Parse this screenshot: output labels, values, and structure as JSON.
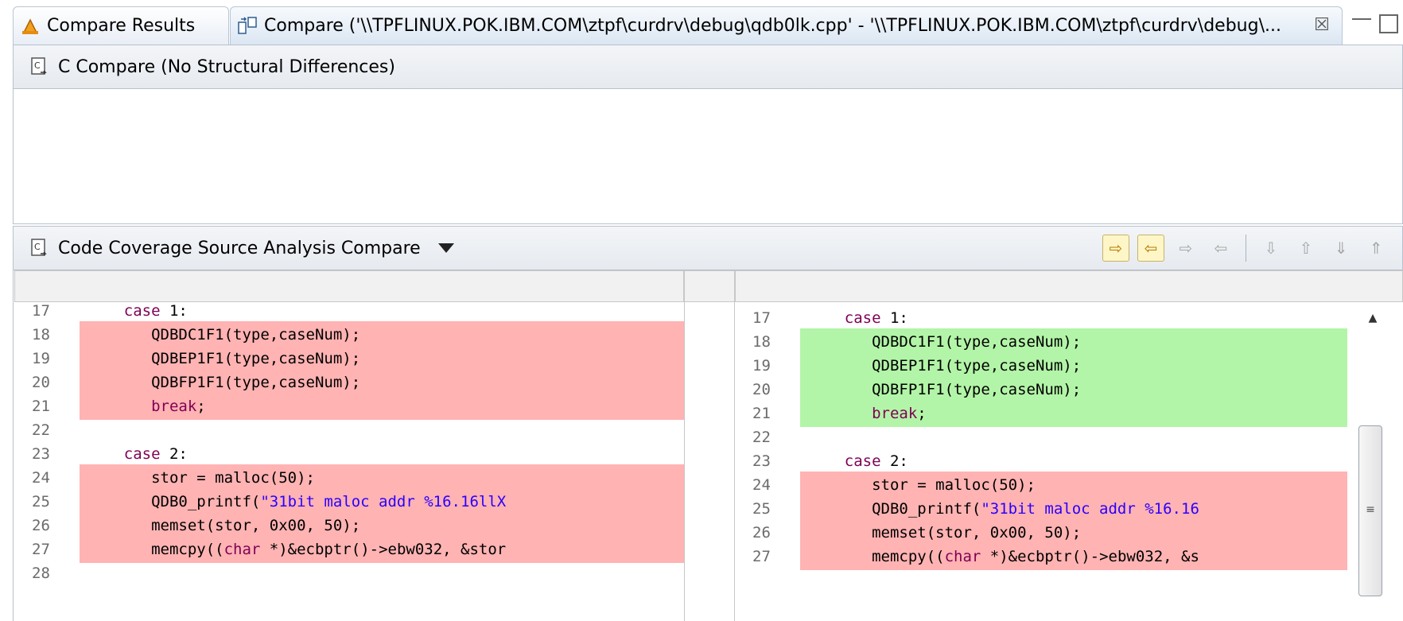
{
  "tabs": {
    "results_label": "Compare Results",
    "compare_label": "Compare ('\\\\TPFLINUX.POK.IBM.COM\\ztpf\\curdrv\\debug\\qdb0lk.cpp' - '\\\\TPFLINUX.POK.IBM.COM\\ztpf\\curdrv\\debug\\...",
    "close_glyph": "☒"
  },
  "structure_panel": {
    "title": "C Compare  (No Structural Differences)"
  },
  "source_panel": {
    "title": "Code Coverage Source Analysis Compare"
  },
  "toolbar": {
    "buttons": [
      "copy-all-left-to-right",
      "copy-all-right-to-left",
      "copy-current-left-to-right",
      "copy-current-right-to-left",
      "next-difference",
      "previous-difference",
      "next-change",
      "previous-change"
    ]
  },
  "colors": {
    "removed": "#ffb3b3",
    "added": "#b3f5a8",
    "keyword": "#7f0055",
    "string": "#2a00ff"
  },
  "left_lines": [
    {
      "n": "17",
      "text": "    case 1:",
      "hl": ""
    },
    {
      "n": "18",
      "text": "       QDBDC1F1(type,caseNum);",
      "hl": "red"
    },
    {
      "n": "19",
      "text": "       QDBEP1F1(type,caseNum);",
      "hl": "red"
    },
    {
      "n": "20",
      "text": "       QDBFP1F1(type,caseNum);",
      "hl": "red"
    },
    {
      "n": "21",
      "text": "       break;",
      "hl": "red"
    },
    {
      "n": "22",
      "text": "",
      "hl": ""
    },
    {
      "n": "23",
      "text": "    case 2:",
      "hl": ""
    },
    {
      "n": "24",
      "text": "       stor = malloc(50);",
      "hl": "red"
    },
    {
      "n": "25",
      "text": "       QDB0_printf(\"31bit maloc addr %16.16llX",
      "hl": "red"
    },
    {
      "n": "26",
      "text": "       memset(stor, 0x00, 50);",
      "hl": "red"
    },
    {
      "n": "27",
      "text": "       memcpy((char *)&ecbptr()->ebw032, &stor",
      "hl": "red"
    },
    {
      "n": "28",
      "text": "",
      "hl": ""
    }
  ],
  "right_lines": [
    {
      "n": "17",
      "text": "    case 1:",
      "hl": ""
    },
    {
      "n": "18",
      "text": "       QDBDC1F1(type,caseNum);",
      "hl": "green"
    },
    {
      "n": "19",
      "text": "       QDBEP1F1(type,caseNum);",
      "hl": "green"
    },
    {
      "n": "20",
      "text": "       QDBFP1F1(type,caseNum);",
      "hl": "green"
    },
    {
      "n": "21",
      "text": "       break;",
      "hl": "green"
    },
    {
      "n": "22",
      "text": "",
      "hl": ""
    },
    {
      "n": "23",
      "text": "    case 2:",
      "hl": ""
    },
    {
      "n": "24",
      "text": "       stor = malloc(50);",
      "hl": "red"
    },
    {
      "n": "25",
      "text": "       QDB0_printf(\"31bit maloc addr %16.16",
      "hl": "red"
    },
    {
      "n": "26",
      "text": "       memset(stor, 0x00, 50);",
      "hl": "red"
    },
    {
      "n": "27",
      "text": "       memcpy((char *)&ecbptr()->ebw032, &s",
      "hl": "red"
    }
  ]
}
